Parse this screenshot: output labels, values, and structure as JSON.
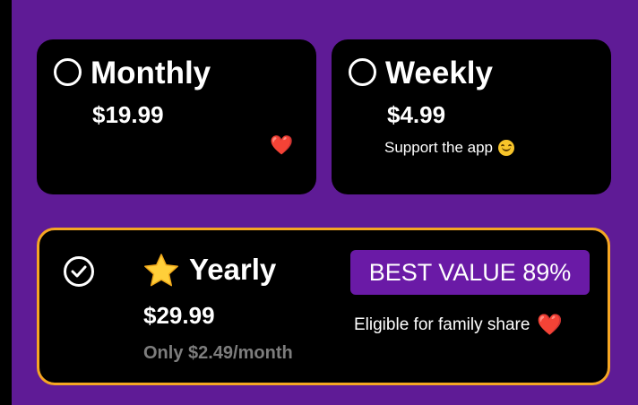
{
  "plans": {
    "monthly": {
      "name": "Monthly",
      "price": "$19.99",
      "selected": false,
      "heart_emoji": "❤️"
    },
    "weekly": {
      "name": "Weekly",
      "price": "$4.99",
      "note": "Support the app",
      "selected": false,
      "emoji_icon": "smiling-face-icon"
    },
    "yearly": {
      "name": "Yearly",
      "price": "$29.99",
      "per_month": "Only $2.49/month",
      "badge": "BEST VALUE 89%",
      "note": "Eligible for family share",
      "heart_emoji": "❤️",
      "selected": true,
      "emoji_icon": "star-icon"
    }
  },
  "colors": {
    "background": "#5f1b96",
    "card": "#000000",
    "selected_border": "#f5a623",
    "badge": "#6a1aa6",
    "muted_text": "#7d7d7d"
  }
}
